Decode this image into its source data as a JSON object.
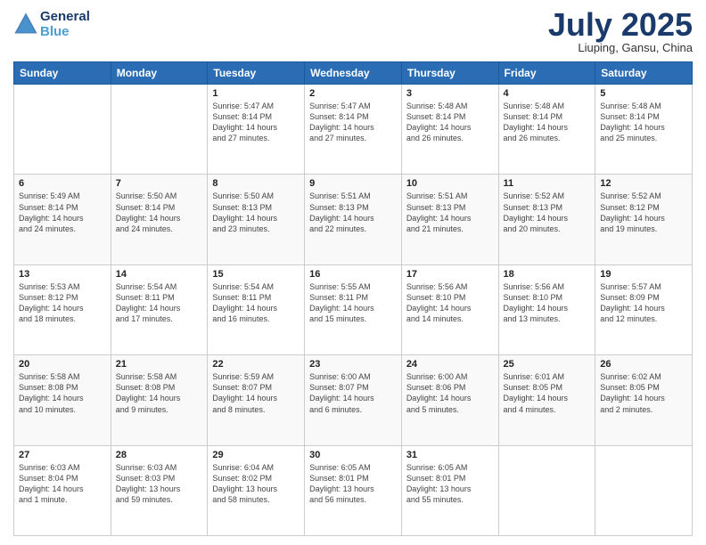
{
  "header": {
    "logo_line1": "General",
    "logo_line2": "Blue",
    "month": "July 2025",
    "location": "Liuping, Gansu, China"
  },
  "weekdays": [
    "Sunday",
    "Monday",
    "Tuesday",
    "Wednesday",
    "Thursday",
    "Friday",
    "Saturday"
  ],
  "weeks": [
    [
      {
        "day": "",
        "content": ""
      },
      {
        "day": "",
        "content": ""
      },
      {
        "day": "1",
        "content": "Sunrise: 5:47 AM\nSunset: 8:14 PM\nDaylight: 14 hours\nand 27 minutes."
      },
      {
        "day": "2",
        "content": "Sunrise: 5:47 AM\nSunset: 8:14 PM\nDaylight: 14 hours\nand 27 minutes."
      },
      {
        "day": "3",
        "content": "Sunrise: 5:48 AM\nSunset: 8:14 PM\nDaylight: 14 hours\nand 26 minutes."
      },
      {
        "day": "4",
        "content": "Sunrise: 5:48 AM\nSunset: 8:14 PM\nDaylight: 14 hours\nand 26 minutes."
      },
      {
        "day": "5",
        "content": "Sunrise: 5:48 AM\nSunset: 8:14 PM\nDaylight: 14 hours\nand 25 minutes."
      }
    ],
    [
      {
        "day": "6",
        "content": "Sunrise: 5:49 AM\nSunset: 8:14 PM\nDaylight: 14 hours\nand 24 minutes."
      },
      {
        "day": "7",
        "content": "Sunrise: 5:50 AM\nSunset: 8:14 PM\nDaylight: 14 hours\nand 24 minutes."
      },
      {
        "day": "8",
        "content": "Sunrise: 5:50 AM\nSunset: 8:13 PM\nDaylight: 14 hours\nand 23 minutes."
      },
      {
        "day": "9",
        "content": "Sunrise: 5:51 AM\nSunset: 8:13 PM\nDaylight: 14 hours\nand 22 minutes."
      },
      {
        "day": "10",
        "content": "Sunrise: 5:51 AM\nSunset: 8:13 PM\nDaylight: 14 hours\nand 21 minutes."
      },
      {
        "day": "11",
        "content": "Sunrise: 5:52 AM\nSunset: 8:13 PM\nDaylight: 14 hours\nand 20 minutes."
      },
      {
        "day": "12",
        "content": "Sunrise: 5:52 AM\nSunset: 8:12 PM\nDaylight: 14 hours\nand 19 minutes."
      }
    ],
    [
      {
        "day": "13",
        "content": "Sunrise: 5:53 AM\nSunset: 8:12 PM\nDaylight: 14 hours\nand 18 minutes."
      },
      {
        "day": "14",
        "content": "Sunrise: 5:54 AM\nSunset: 8:11 PM\nDaylight: 14 hours\nand 17 minutes."
      },
      {
        "day": "15",
        "content": "Sunrise: 5:54 AM\nSunset: 8:11 PM\nDaylight: 14 hours\nand 16 minutes."
      },
      {
        "day": "16",
        "content": "Sunrise: 5:55 AM\nSunset: 8:11 PM\nDaylight: 14 hours\nand 15 minutes."
      },
      {
        "day": "17",
        "content": "Sunrise: 5:56 AM\nSunset: 8:10 PM\nDaylight: 14 hours\nand 14 minutes."
      },
      {
        "day": "18",
        "content": "Sunrise: 5:56 AM\nSunset: 8:10 PM\nDaylight: 14 hours\nand 13 minutes."
      },
      {
        "day": "19",
        "content": "Sunrise: 5:57 AM\nSunset: 8:09 PM\nDaylight: 14 hours\nand 12 minutes."
      }
    ],
    [
      {
        "day": "20",
        "content": "Sunrise: 5:58 AM\nSunset: 8:08 PM\nDaylight: 14 hours\nand 10 minutes."
      },
      {
        "day": "21",
        "content": "Sunrise: 5:58 AM\nSunset: 8:08 PM\nDaylight: 14 hours\nand 9 minutes."
      },
      {
        "day": "22",
        "content": "Sunrise: 5:59 AM\nSunset: 8:07 PM\nDaylight: 14 hours\nand 8 minutes."
      },
      {
        "day": "23",
        "content": "Sunrise: 6:00 AM\nSunset: 8:07 PM\nDaylight: 14 hours\nand 6 minutes."
      },
      {
        "day": "24",
        "content": "Sunrise: 6:00 AM\nSunset: 8:06 PM\nDaylight: 14 hours\nand 5 minutes."
      },
      {
        "day": "25",
        "content": "Sunrise: 6:01 AM\nSunset: 8:05 PM\nDaylight: 14 hours\nand 4 minutes."
      },
      {
        "day": "26",
        "content": "Sunrise: 6:02 AM\nSunset: 8:05 PM\nDaylight: 14 hours\nand 2 minutes."
      }
    ],
    [
      {
        "day": "27",
        "content": "Sunrise: 6:03 AM\nSunset: 8:04 PM\nDaylight: 14 hours\nand 1 minute."
      },
      {
        "day": "28",
        "content": "Sunrise: 6:03 AM\nSunset: 8:03 PM\nDaylight: 13 hours\nand 59 minutes."
      },
      {
        "day": "29",
        "content": "Sunrise: 6:04 AM\nSunset: 8:02 PM\nDaylight: 13 hours\nand 58 minutes."
      },
      {
        "day": "30",
        "content": "Sunrise: 6:05 AM\nSunset: 8:01 PM\nDaylight: 13 hours\nand 56 minutes."
      },
      {
        "day": "31",
        "content": "Sunrise: 6:05 AM\nSunset: 8:01 PM\nDaylight: 13 hours\nand 55 minutes."
      },
      {
        "day": "",
        "content": ""
      },
      {
        "day": "",
        "content": ""
      }
    ]
  ]
}
